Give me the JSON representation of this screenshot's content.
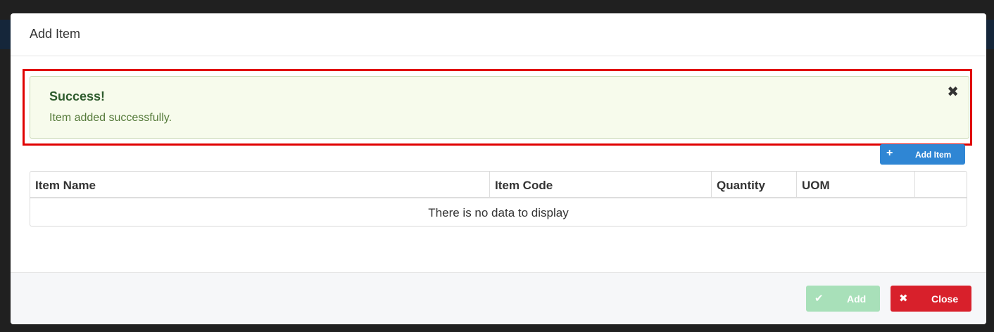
{
  "modal": {
    "title": "Add Item"
  },
  "alert": {
    "title": "Success!",
    "message": "Item added successfully.",
    "close_glyph": "✖"
  },
  "toolbar": {
    "add_item_icon": "plus-icon",
    "add_item_label": "Add Item",
    "add_item_glyph": "+"
  },
  "grid": {
    "columns": [
      "Item Name",
      "Item Code",
      "Quantity",
      "UOM",
      ""
    ],
    "empty_message": "There is no data to display"
  },
  "footer": {
    "add_label": "Add",
    "add_glyph": "✔",
    "close_label": "Close",
    "close_glyph": "✖"
  },
  "colors": {
    "success_bg": "#f7fbec",
    "success_text": "#2d5b2c",
    "primary": "#2f86d4",
    "add_disabled": "#a8e0b9",
    "danger": "#d8202b",
    "highlight": "#e00000"
  }
}
